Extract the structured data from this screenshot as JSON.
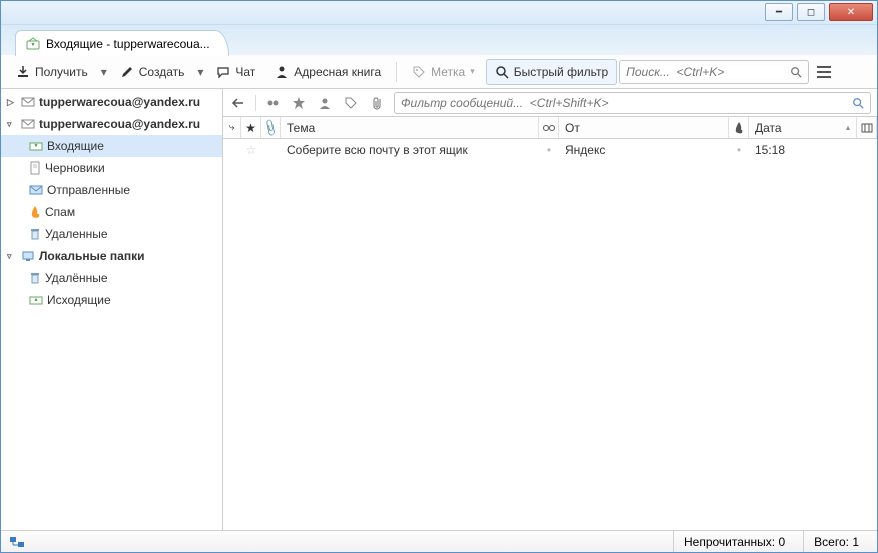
{
  "tab": {
    "title": "Входящие - tupperwarecoua..."
  },
  "toolbar": {
    "get": "Получить",
    "write": "Создать",
    "chat": "Чат",
    "address": "Адресная книга",
    "tag": "Метка",
    "quickfilter": "Быстрый фильтр",
    "search_placeholder": "Поиск...  <Ctrl+K>"
  },
  "sidebar": {
    "acct1": "tupperwarecoua@yandex.ru",
    "acct2": "tupperwarecoua@yandex.ru",
    "inbox": "Входящие",
    "drafts": "Черновики",
    "sent": "Отправленные",
    "spam": "Спам",
    "trash": "Удаленные",
    "local": "Локальные папки",
    "ltrash": "Удалённые",
    "outbox": "Исходящие"
  },
  "filter": {
    "placeholder": "Фильтр сообщений...  <Ctrl+Shift+K>"
  },
  "columns": {
    "subject": "Тема",
    "from": "От",
    "date": "Дата"
  },
  "messages": [
    {
      "subject": "Соберите всю почту в этот ящик",
      "from": "Яндекс",
      "date": "15:18"
    }
  ],
  "status": {
    "unread_label": "Непрочитанных:",
    "unread": "0",
    "total_label": "Всего:",
    "total": "1"
  }
}
